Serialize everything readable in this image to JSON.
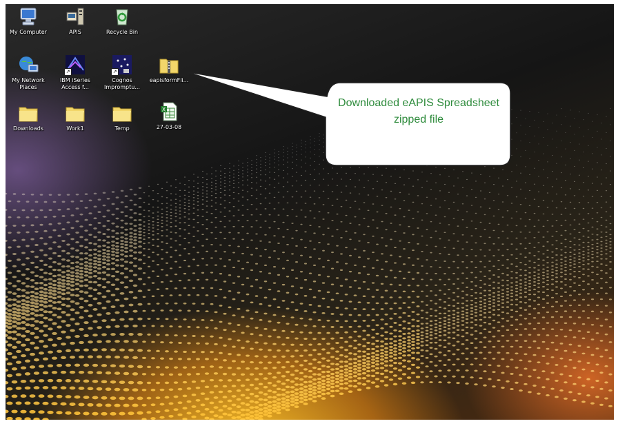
{
  "desktop": {
    "icons": [
      {
        "label": "My Computer",
        "icon": "my-computer-icon"
      },
      {
        "label": "APIS",
        "icon": "apis-app-icon"
      },
      {
        "label": "Recycle Bin",
        "icon": "recycle-bin-icon"
      },
      {
        "label": "My Network Places",
        "icon": "network-places-icon"
      },
      {
        "label": "IBM iSeries Access f...",
        "icon": "ibm-iseries-icon"
      },
      {
        "label": "Cognos Impromptu...",
        "icon": "cognos-icon"
      },
      {
        "label": "eapisformFli...",
        "icon": "zip-folder-icon"
      },
      {
        "label": "Downloads",
        "icon": "folder-icon"
      },
      {
        "label": "Work1",
        "icon": "folder-icon"
      },
      {
        "label": "Temp",
        "icon": "folder-icon"
      },
      {
        "label": "27-03-08",
        "icon": "excel-file-icon"
      }
    ]
  },
  "callout": {
    "text": "Downloaded eAPIS Spreadsheet zipped file",
    "text_color": "#2e8b3c"
  }
}
